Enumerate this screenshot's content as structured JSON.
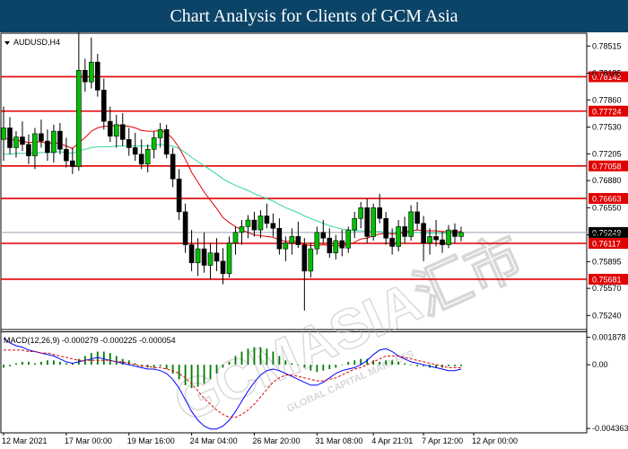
{
  "header": {
    "title": "Chart Analysis for Clients of GCM Asia"
  },
  "watermark": {
    "brand": "GCMASIA汇市",
    "sub": "GLOBAL CAPITAL MARKETS"
  },
  "chart_data": {
    "type": "candlestick",
    "symbol_label": "AUDUSD,H4",
    "price_ticks": [
      "0.78515",
      "0.78185",
      "0.77860",
      "0.77530",
      "0.77205",
      "0.76880",
      "0.76550",
      "0.76220",
      "0.75895",
      "0.75570",
      "0.75240"
    ],
    "price_tick_values": [
      0.78515,
      0.78185,
      0.7786,
      0.7753,
      0.77205,
      0.7688,
      0.7655,
      0.7622,
      0.75895,
      0.7557,
      0.7524
    ],
    "price_range": [
      0.7508,
      0.7866
    ],
    "levels": [
      {
        "value": 0.78142,
        "label": "0.78142"
      },
      {
        "value": 0.77724,
        "label": "0.77724"
      },
      {
        "value": 0.77058,
        "label": "0.77058"
      },
      {
        "value": 0.76663,
        "label": "0.76663"
      },
      {
        "value": 0.76117,
        "label": "0.76117"
      },
      {
        "value": 0.75681,
        "label": "0.75681"
      }
    ],
    "current_price": {
      "value": 0.76249,
      "label": "0.76249"
    },
    "candles": [
      {
        "o": 0.7738,
        "h": 0.7778,
        "l": 0.7712,
        "c": 0.7752
      },
      {
        "o": 0.7752,
        "h": 0.7765,
        "l": 0.772,
        "c": 0.7728
      },
      {
        "o": 0.7728,
        "h": 0.7748,
        "l": 0.7716,
        "c": 0.7741
      },
      {
        "o": 0.7741,
        "h": 0.776,
        "l": 0.7724,
        "c": 0.7732
      },
      {
        "o": 0.7732,
        "h": 0.7744,
        "l": 0.7708,
        "c": 0.7718
      },
      {
        "o": 0.7718,
        "h": 0.7752,
        "l": 0.7702,
        "c": 0.7745
      },
      {
        "o": 0.7745,
        "h": 0.7762,
        "l": 0.7728,
        "c": 0.7736
      },
      {
        "o": 0.7736,
        "h": 0.775,
        "l": 0.7712,
        "c": 0.7722
      },
      {
        "o": 0.7722,
        "h": 0.7756,
        "l": 0.771,
        "c": 0.7748
      },
      {
        "o": 0.7748,
        "h": 0.7758,
        "l": 0.772,
        "c": 0.7726
      },
      {
        "o": 0.7726,
        "h": 0.774,
        "l": 0.7704,
        "c": 0.7712
      },
      {
        "o": 0.7712,
        "h": 0.7728,
        "l": 0.7696,
        "c": 0.7705
      },
      {
        "o": 0.7705,
        "h": 0.7868,
        "l": 0.77,
        "c": 0.7822
      },
      {
        "o": 0.7822,
        "h": 0.7836,
        "l": 0.7796,
        "c": 0.7808
      },
      {
        "o": 0.7808,
        "h": 0.7862,
        "l": 0.78,
        "c": 0.7832
      },
      {
        "o": 0.7832,
        "h": 0.7842,
        "l": 0.779,
        "c": 0.7798
      },
      {
        "o": 0.7798,
        "h": 0.7812,
        "l": 0.775,
        "c": 0.776
      },
      {
        "o": 0.776,
        "h": 0.7778,
        "l": 0.7735,
        "c": 0.7742
      },
      {
        "o": 0.7742,
        "h": 0.7768,
        "l": 0.7728,
        "c": 0.7756
      },
      {
        "o": 0.7756,
        "h": 0.777,
        "l": 0.773,
        "c": 0.7738
      },
      {
        "o": 0.7738,
        "h": 0.7752,
        "l": 0.7718,
        "c": 0.7728
      },
      {
        "o": 0.7728,
        "h": 0.7746,
        "l": 0.7712,
        "c": 0.772
      },
      {
        "o": 0.772,
        "h": 0.7738,
        "l": 0.7702,
        "c": 0.7708
      },
      {
        "o": 0.7708,
        "h": 0.7732,
        "l": 0.7698,
        "c": 0.7726
      },
      {
        "o": 0.7726,
        "h": 0.7748,
        "l": 0.7715,
        "c": 0.774
      },
      {
        "o": 0.774,
        "h": 0.7758,
        "l": 0.7728,
        "c": 0.775
      },
      {
        "o": 0.775,
        "h": 0.7756,
        "l": 0.7715,
        "c": 0.772
      },
      {
        "o": 0.772,
        "h": 0.7728,
        "l": 0.768,
        "c": 0.769
      },
      {
        "o": 0.769,
        "h": 0.7702,
        "l": 0.764,
        "c": 0.765
      },
      {
        "o": 0.765,
        "h": 0.766,
        "l": 0.76,
        "c": 0.761
      },
      {
        "o": 0.761,
        "h": 0.7628,
        "l": 0.7578,
        "c": 0.7588
      },
      {
        "o": 0.7588,
        "h": 0.7618,
        "l": 0.7572,
        "c": 0.7605
      },
      {
        "o": 0.7605,
        "h": 0.7625,
        "l": 0.7576,
        "c": 0.7585
      },
      {
        "o": 0.7585,
        "h": 0.7612,
        "l": 0.7568,
        "c": 0.76
      },
      {
        "o": 0.76,
        "h": 0.7618,
        "l": 0.7578,
        "c": 0.759
      },
      {
        "o": 0.759,
        "h": 0.7606,
        "l": 0.7562,
        "c": 0.7575
      },
      {
        "o": 0.7575,
        "h": 0.762,
        "l": 0.757,
        "c": 0.7612
      },
      {
        "o": 0.7612,
        "h": 0.7632,
        "l": 0.7598,
        "c": 0.7625
      },
      {
        "o": 0.7625,
        "h": 0.764,
        "l": 0.761,
        "c": 0.7632
      },
      {
        "o": 0.7632,
        "h": 0.7646,
        "l": 0.7618,
        "c": 0.764
      },
      {
        "o": 0.764,
        "h": 0.765,
        "l": 0.762,
        "c": 0.7628
      },
      {
        "o": 0.7628,
        "h": 0.7652,
        "l": 0.7618,
        "c": 0.7645
      },
      {
        "o": 0.7645,
        "h": 0.766,
        "l": 0.763,
        "c": 0.7636
      },
      {
        "o": 0.7636,
        "h": 0.7648,
        "l": 0.762,
        "c": 0.763
      },
      {
        "o": 0.763,
        "h": 0.7642,
        "l": 0.7598,
        "c": 0.7605
      },
      {
        "o": 0.7605,
        "h": 0.762,
        "l": 0.759,
        "c": 0.7612
      },
      {
        "o": 0.7612,
        "h": 0.763,
        "l": 0.7598,
        "c": 0.762
      },
      {
        "o": 0.762,
        "h": 0.7638,
        "l": 0.7606,
        "c": 0.761
      },
      {
        "o": 0.761,
        "h": 0.7618,
        "l": 0.753,
        "c": 0.7578
      },
      {
        "o": 0.7578,
        "h": 0.7612,
        "l": 0.757,
        "c": 0.7605
      },
      {
        "o": 0.7605,
        "h": 0.7632,
        "l": 0.7598,
        "c": 0.7625
      },
      {
        "o": 0.7625,
        "h": 0.764,
        "l": 0.7612,
        "c": 0.7618
      },
      {
        "o": 0.7618,
        "h": 0.763,
        "l": 0.7594,
        "c": 0.76
      },
      {
        "o": 0.76,
        "h": 0.7622,
        "l": 0.7592,
        "c": 0.7615
      },
      {
        "o": 0.7615,
        "h": 0.7628,
        "l": 0.7596,
        "c": 0.7606
      },
      {
        "o": 0.7606,
        "h": 0.7632,
        "l": 0.76,
        "c": 0.7628
      },
      {
        "o": 0.7628,
        "h": 0.765,
        "l": 0.7618,
        "c": 0.7642
      },
      {
        "o": 0.7642,
        "h": 0.7662,
        "l": 0.763,
        "c": 0.7655
      },
      {
        "o": 0.7655,
        "h": 0.7666,
        "l": 0.7612,
        "c": 0.762
      },
      {
        "o": 0.762,
        "h": 0.766,
        "l": 0.7615,
        "c": 0.7655
      },
      {
        "o": 0.7655,
        "h": 0.7672,
        "l": 0.7636,
        "c": 0.7642
      },
      {
        "o": 0.7642,
        "h": 0.765,
        "l": 0.761,
        "c": 0.7618
      },
      {
        "o": 0.7618,
        "h": 0.763,
        "l": 0.7598,
        "c": 0.7608
      },
      {
        "o": 0.7608,
        "h": 0.764,
        "l": 0.7602,
        "c": 0.7632
      },
      {
        "o": 0.7632,
        "h": 0.7644,
        "l": 0.7612,
        "c": 0.762
      },
      {
        "o": 0.762,
        "h": 0.7658,
        "l": 0.7615,
        "c": 0.765
      },
      {
        "o": 0.765,
        "h": 0.7662,
        "l": 0.7628,
        "c": 0.7636
      },
      {
        "o": 0.7636,
        "h": 0.7645,
        "l": 0.759,
        "c": 0.7612
      },
      {
        "o": 0.7612,
        "h": 0.763,
        "l": 0.7598,
        "c": 0.762
      },
      {
        "o": 0.762,
        "h": 0.764,
        "l": 0.7608,
        "c": 0.7616
      },
      {
        "o": 0.7616,
        "h": 0.7626,
        "l": 0.76,
        "c": 0.761
      },
      {
        "o": 0.761,
        "h": 0.7634,
        "l": 0.7606,
        "c": 0.7628
      },
      {
        "o": 0.7628,
        "h": 0.7636,
        "l": 0.7612,
        "c": 0.762
      },
      {
        "o": 0.762,
        "h": 0.7632,
        "l": 0.7614,
        "c": 0.7625
      }
    ],
    "ma_red": [
      0.774,
      0.7738,
      0.7737,
      0.7736,
      0.7734,
      0.7735,
      0.7735,
      0.7733,
      0.7734,
      0.7733,
      0.773,
      0.7727,
      0.7734,
      0.774,
      0.7748,
      0.7752,
      0.7754,
      0.7754,
      0.7755,
      0.7755,
      0.7754,
      0.7752,
      0.7749,
      0.7748,
      0.7748,
      0.7749,
      0.7746,
      0.7739,
      0.7728,
      0.7714,
      0.7698,
      0.7686,
      0.7674,
      0.7664,
      0.7654,
      0.7643,
      0.7637,
      0.7632,
      0.7628,
      0.7625,
      0.7622,
      0.7621,
      0.762,
      0.7619,
      0.7616,
      0.7614,
      0.7614,
      0.7614,
      0.761,
      0.7609,
      0.7609,
      0.761,
      0.7609,
      0.7609,
      0.7609,
      0.761,
      0.7613,
      0.7617,
      0.7618,
      0.7621,
      0.7623,
      0.7624,
      0.7623,
      0.7624,
      0.7625,
      0.7627,
      0.7628,
      0.7627,
      0.7627,
      0.7627,
      0.7626,
      0.7626,
      0.7626,
      0.7626
    ],
    "ma_green": [
      0.772,
      0.772,
      0.7721,
      0.7721,
      0.7721,
      0.7722,
      0.7722,
      0.7722,
      0.7723,
      0.7723,
      0.7722,
      0.7721,
      0.7724,
      0.7726,
      0.7728,
      0.7729,
      0.7729,
      0.7729,
      0.773,
      0.773,
      0.773,
      0.773,
      0.773,
      0.773,
      0.7731,
      0.7732,
      0.7731,
      0.773,
      0.7727,
      0.7722,
      0.7716,
      0.7711,
      0.7706,
      0.7701,
      0.7696,
      0.769,
      0.7686,
      0.7682,
      0.7679,
      0.7676,
      0.7672,
      0.7669,
      0.7666,
      0.7663,
      0.7659,
      0.7655,
      0.7652,
      0.7649,
      0.7645,
      0.7642,
      0.7639,
      0.7636,
      0.7633,
      0.7631,
      0.7629,
      0.7628,
      0.7627,
      0.7627,
      0.7626,
      0.7626,
      0.7626,
      0.7625,
      0.7625,
      0.7625,
      0.7625,
      0.7625,
      0.7625,
      0.7624,
      0.7624,
      0.7624,
      0.7624,
      0.7624,
      0.7624,
      0.7624
    ],
    "macd": {
      "label": "MACD(12,26,9) -0.000279 -0.000225 -0.000054",
      "ticks": [
        "0.001878",
        "0.00",
        "-0.004363"
      ],
      "tick_values": [
        0.001878,
        0.0,
        -0.004363
      ],
      "range": [
        -0.0046,
        0.0021
      ],
      "hist": [
        -0.0002,
        -0.0001,
        0.0001,
        0.0002,
        0.0002,
        0.0001,
        0.0002,
        0.0003,
        0.0003,
        0.0002,
        0.0001,
        0.0001,
        0.0004,
        0.0006,
        0.0008,
        0.0009,
        0.0009,
        0.0008,
        0.0006,
        0.0004,
        0.0003,
        0.0001,
        -0.0001,
        -0.0002,
        -0.0002,
        -0.0001,
        -0.0003,
        -0.0006,
        -0.001,
        -0.0014,
        -0.0016,
        -0.0015,
        -0.0013,
        -0.001,
        -0.0006,
        -0.0002,
        0.0002,
        0.0006,
        0.0009,
        0.0011,
        0.0012,
        0.0012,
        0.0011,
        0.0009,
        0.0006,
        0.0003,
        0.0001,
        0.0,
        -0.0002,
        -0.0004,
        -0.0005,
        -0.0004,
        -0.0003,
        -0.0002,
        0.0,
        0.0002,
        0.0003,
        0.0004,
        0.0004,
        0.0003,
        0.0002,
        0.0003,
        0.0003,
        0.0002,
        0.0001,
        0.0,
        -0.0001,
        -0.0001,
        -0.0002,
        -0.0002,
        -0.0002,
        -0.0001,
        -0.0001,
        -0.0001
      ],
      "macd_line": [
        0.0018,
        0.0015,
        0.0013,
        0.0012,
        0.001,
        0.0009,
        0.0008,
        0.0007,
        0.0006,
        0.0004,
        0.0002,
        0.0001,
        0.0002,
        0.0003,
        0.0004,
        0.0005,
        0.0004,
        0.0003,
        0.0002,
        0.0001,
        0.0,
        -0.0001,
        -0.0002,
        -0.0003,
        -0.0003,
        -0.0004,
        -0.0006,
        -0.001,
        -0.0016,
        -0.0024,
        -0.0032,
        -0.0038,
        -0.0042,
        -0.0044,
        -0.0044,
        -0.0042,
        -0.0038,
        -0.0032,
        -0.0025,
        -0.0018,
        -0.0012,
        -0.0007,
        -0.0004,
        -0.0003,
        -0.0004,
        -0.0006,
        -0.0008,
        -0.001,
        -0.0012,
        -0.0014,
        -0.0014,
        -0.0012,
        -0.0009,
        -0.0006,
        -0.0004,
        -0.0003,
        -0.0002,
        0.0,
        0.0003,
        0.0007,
        0.001,
        0.0011,
        0.0009,
        0.0006,
        0.0004,
        0.0002,
        0.0001,
        0.0,
        -0.0001,
        -0.0002,
        -0.0003,
        -0.0004,
        -0.0004,
        -0.0003
      ],
      "signal_line": [
        0.001,
        0.001,
        0.001,
        0.001,
        0.0009,
        0.0009,
        0.0008,
        0.0008,
        0.0007,
        0.0006,
        0.0005,
        0.0004,
        0.0003,
        0.0003,
        0.0003,
        0.0003,
        0.0003,
        0.0003,
        0.0002,
        0.0002,
        0.0001,
        0.0,
        -0.0001,
        -0.0001,
        -0.0002,
        -0.0002,
        -0.0003,
        -0.0004,
        -0.0006,
        -0.0009,
        -0.0013,
        -0.0018,
        -0.0023,
        -0.0027,
        -0.0031,
        -0.0034,
        -0.0036,
        -0.0036,
        -0.0034,
        -0.0031,
        -0.0027,
        -0.0022,
        -0.0017,
        -0.0012,
        -0.0009,
        -0.0007,
        -0.0007,
        -0.0008,
        -0.0009,
        -0.001,
        -0.0011,
        -0.0011,
        -0.001,
        -0.0009,
        -0.0007,
        -0.0005,
        -0.0003,
        -0.0002,
        0.0,
        0.0002,
        0.0004,
        0.0006,
        0.0006,
        0.0006,
        0.0005,
        0.0004,
        0.0003,
        0.0002,
        0.0001,
        0.0,
        -0.0001,
        -0.0002,
        -0.0002,
        -0.0002
      ]
    },
    "time_labels": [
      {
        "label": "12 Mar 2021",
        "index": 0
      },
      {
        "label": "17 Mar 00:00",
        "index": 10
      },
      {
        "label": "19 Mar 16:00",
        "index": 20
      },
      {
        "label": "24 Mar 04:00",
        "index": 30
      },
      {
        "label": "26 Mar 20:00",
        "index": 40
      },
      {
        "label": "31 Mar 08:00",
        "index": 50
      },
      {
        "label": "4 Apr 21:01",
        "index": 59
      },
      {
        "label": "7 Apr 12:00",
        "index": 67
      },
      {
        "label": "12 Apr 00:00",
        "index": 75
      }
    ],
    "colors": {
      "level": "#e00000",
      "ma_red": "#e00000",
      "ma_green": "#33d69a",
      "macd_line": "#0000ff",
      "signal_line": "#e00000",
      "hist": "#007a00",
      "current_tag": "#000000"
    }
  }
}
